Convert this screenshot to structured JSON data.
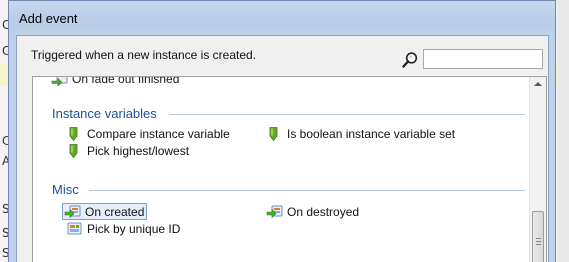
{
  "window": {
    "title": "Add event"
  },
  "background_app": {
    "left_letters": [
      "C",
      "C",
      "C",
      "A",
      "S",
      "S",
      "S"
    ]
  },
  "header": {
    "description": "Triggered when a new instance is created.",
    "search_placeholder": "",
    "search_value": ""
  },
  "partial_item": {
    "label": "On fade out finished",
    "icon": "event-sheet-arrow-icon"
  },
  "categories": [
    {
      "title": "Instance variables",
      "items": [
        {
          "label": "Compare instance variable",
          "icon": "green-flag-icon"
        },
        {
          "label": "Is boolean instance variable set",
          "icon": "green-flag-icon"
        },
        {
          "label": "Pick highest/lowest",
          "icon": "green-flag-icon"
        }
      ]
    },
    {
      "title": "Misc",
      "items": [
        {
          "label": "On created",
          "icon": "event-sheet-arrow-icon",
          "selected": true
        },
        {
          "label": "On destroyed",
          "icon": "event-sheet-arrow-icon"
        },
        {
          "label": "Pick by unique ID",
          "icon": "event-sheet-icon"
        }
      ]
    }
  ],
  "colors": {
    "category_title": "#1d4f95",
    "selection_border": "#7da2ce",
    "selection_fill": "#e6eefb",
    "flag_green": "#6aa728"
  }
}
